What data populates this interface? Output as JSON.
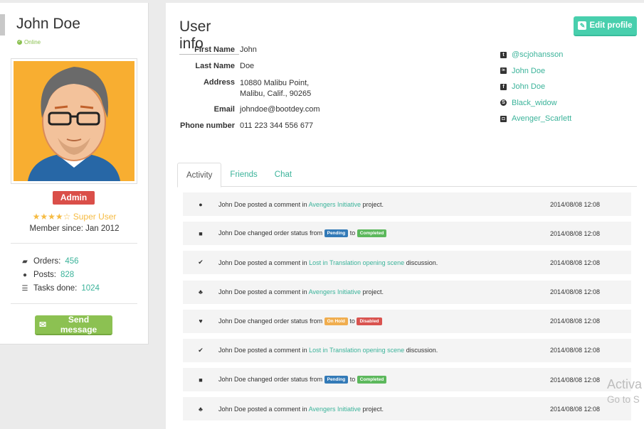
{
  "profile": {
    "name": "John Doe",
    "status": "Online",
    "role": "Admin",
    "rating": 4,
    "rating_max": 5,
    "rating_label": "Super User",
    "member_since": "Member since: Jan 2012",
    "stats": [
      {
        "icon": "truck-icon",
        "label": "Orders:",
        "value": "456"
      },
      {
        "icon": "comment-icon",
        "label": "Posts:",
        "value": "828"
      },
      {
        "icon": "tasks-icon",
        "label": "Tasks done:",
        "value": "1024"
      }
    ],
    "send_message": "Send message"
  },
  "user_info": {
    "title": "User info",
    "edit_profile": "Edit profile",
    "fields": [
      {
        "label": "First Name",
        "value": "John"
      },
      {
        "label": "Last Name",
        "value": "Doe"
      },
      {
        "label": "Address",
        "value": "10880 Malibu Point,",
        "value2": "Malibu, Calif., 90265"
      },
      {
        "label": "Email",
        "value": "johndoe@bootdey.com"
      },
      {
        "label": "Phone number",
        "value": "011 223 344 556 677"
      }
    ],
    "socials": [
      {
        "icon": "twitter-icon",
        "glyph": "t",
        "value": "@scjohansson"
      },
      {
        "icon": "linkedin-icon",
        "glyph": "in",
        "value": "John Doe"
      },
      {
        "icon": "facebook-icon",
        "glyph": "f",
        "value": "John Doe"
      },
      {
        "icon": "skype-icon",
        "glyph": "S",
        "value": "Black_widow"
      },
      {
        "icon": "instagram-icon",
        "glyph": "◘",
        "value": "Avenger_Scarlett"
      }
    ]
  },
  "tabs": [
    {
      "label": "Activity",
      "active": true
    },
    {
      "label": "Friends",
      "active": false
    },
    {
      "label": "Chat",
      "active": false
    }
  ],
  "colors": {
    "accent": "#3bb39a",
    "pending": "#337ab7",
    "completed": "#5cb85c",
    "on_hold": "#f0ad4e",
    "disabled": "#d9534f",
    "admin": "#da4f49",
    "send": "#8cc152",
    "edit": "#48cfad"
  },
  "activity": [
    {
      "icon": "comment-icon",
      "glyph": "●",
      "type": "comment",
      "prefix": "John Doe posted a comment in",
      "link": "Avengers Initiative",
      "suffix": "project.",
      "date": "2014/08/08 12:08"
    },
    {
      "icon": "truck-icon",
      "glyph": "■",
      "type": "status",
      "prefix": "John Doe changed order status from",
      "from": "Pending",
      "from_color": "#337ab7",
      "mid": "to",
      "to": "Completed",
      "to_color": "#5cb85c",
      "date": "2014/08/08 12:08"
    },
    {
      "icon": "check-icon",
      "glyph": "✔",
      "type": "comment",
      "prefix": "John Doe posted a comment in",
      "link": "Lost in Translation opening scene",
      "suffix": "discussion.",
      "date": "2014/08/08 12:08"
    },
    {
      "icon": "users-icon",
      "glyph": "♣",
      "type": "comment",
      "prefix": "John Doe posted a comment in",
      "link": "Avengers Initiative",
      "suffix": "project.",
      "date": "2014/08/08 12:08"
    },
    {
      "icon": "heart-icon",
      "glyph": "♥",
      "type": "status",
      "prefix": "John Doe changed order status from",
      "from": "On Hold",
      "from_color": "#f0ad4e",
      "mid": "to",
      "to": "Disabled",
      "to_color": "#d9534f",
      "date": "2014/08/08 12:08"
    },
    {
      "icon": "check-icon",
      "glyph": "✔",
      "type": "comment",
      "prefix": "John Doe posted a comment in",
      "link": "Lost in Translation opening scene",
      "suffix": "discussion.",
      "date": "2014/08/08 12:08"
    },
    {
      "icon": "truck-icon",
      "glyph": "■",
      "type": "status",
      "prefix": "John Doe changed order status from",
      "from": "Pending",
      "from_color": "#337ab7",
      "mid": "to",
      "to": "Completed",
      "to_color": "#5cb85c",
      "date": "2014/08/08 12:08"
    },
    {
      "icon": "users-icon",
      "glyph": "♣",
      "type": "comment",
      "prefix": "John Doe posted a comment in",
      "link": "Avengers Initiative",
      "suffix": "project.",
      "date": "2014/08/08 12:08"
    }
  ],
  "watermark": {
    "line1": "Activa",
    "line2": "Go to S"
  }
}
